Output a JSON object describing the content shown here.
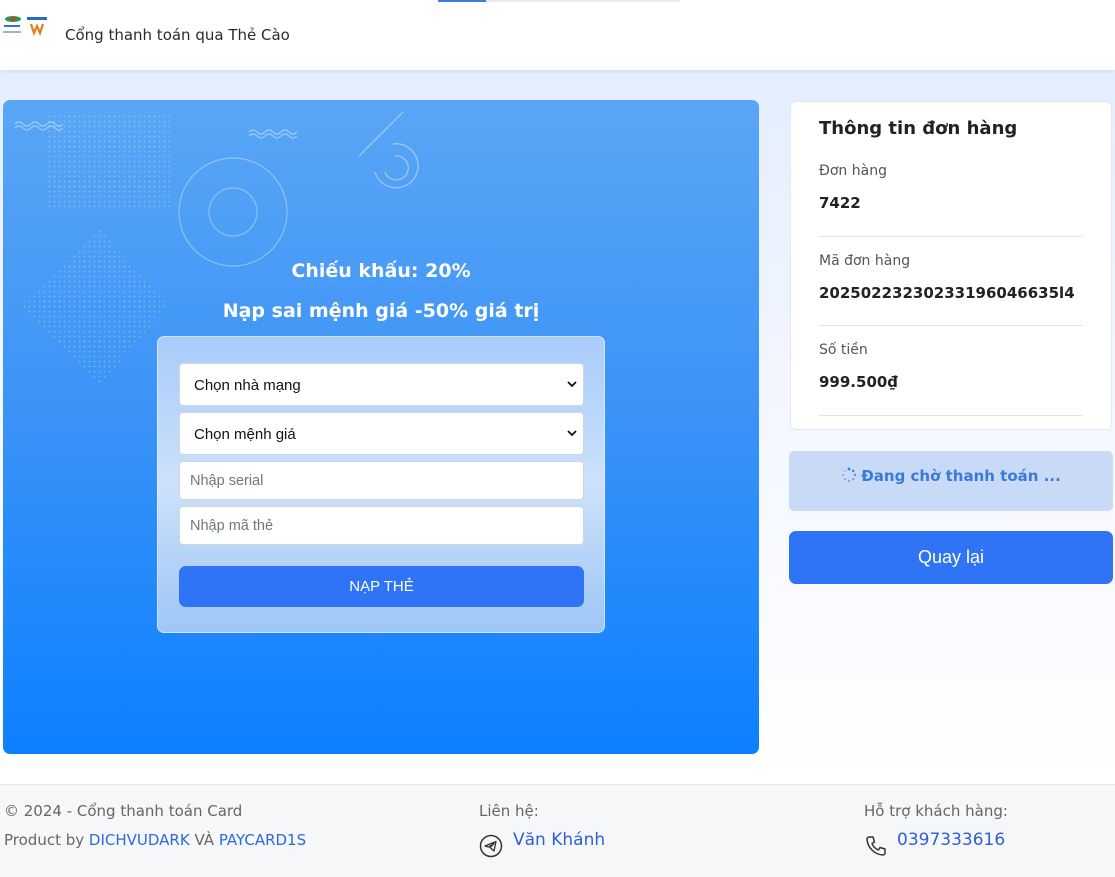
{
  "header": {
    "site_title": "Cổng thanh toán qua Thẻ Cào"
  },
  "payment_panel": {
    "discount_text": "Chiếu khấu: 20%",
    "wrong_value_text": "Nạp sai mệnh giá -50% giá trị",
    "form": {
      "carrier_select": {
        "selected": "Chọn nhà mạng"
      },
      "value_select": {
        "selected": "Chọn mệnh giá"
      },
      "serial_input": {
        "value": "",
        "placeholder": "Nhập serial"
      },
      "code_input": {
        "value": "",
        "placeholder": "Nhập mã thẻ"
      },
      "submit_label": "NẠP THẺ"
    }
  },
  "order_info": {
    "title": "Thông tin đơn hàng",
    "fields": [
      {
        "label": "Đơn hàng",
        "value": "7422"
      },
      {
        "label": "Mã đơn hàng",
        "value": "20250223230233196046635l4"
      },
      {
        "label": "Số tiền",
        "value": "999.500₫"
      }
    ]
  },
  "status": {
    "text": "Đang chờ thanh toán ..."
  },
  "back_button": {
    "label": "Quay lại"
  },
  "footer": {
    "copyright": "© 2024 - Cổng thanh toán Card",
    "product_by": "Product by",
    "link1": "DICHVUDARK",
    "and": "VÀ",
    "link2": "PAYCARD1S",
    "contact_label": "Liên hệ:",
    "contact_name": "Văn Khánh",
    "support_label": "Hỗ trợ khách hàng:",
    "support_phone": "0397333616"
  },
  "colors": {
    "primary": "#2e74f5",
    "panel_top": "#5aa6f5",
    "panel_bottom": "#0d80ff",
    "status_bg": "#c9daf6",
    "status_text": "#3a7bd8",
    "link": "#2d6ae0"
  },
  "icons": [
    "carrier-logo-icon",
    "chevron-down-icon",
    "spinner-icon",
    "telegram-icon",
    "phone-icon"
  ]
}
